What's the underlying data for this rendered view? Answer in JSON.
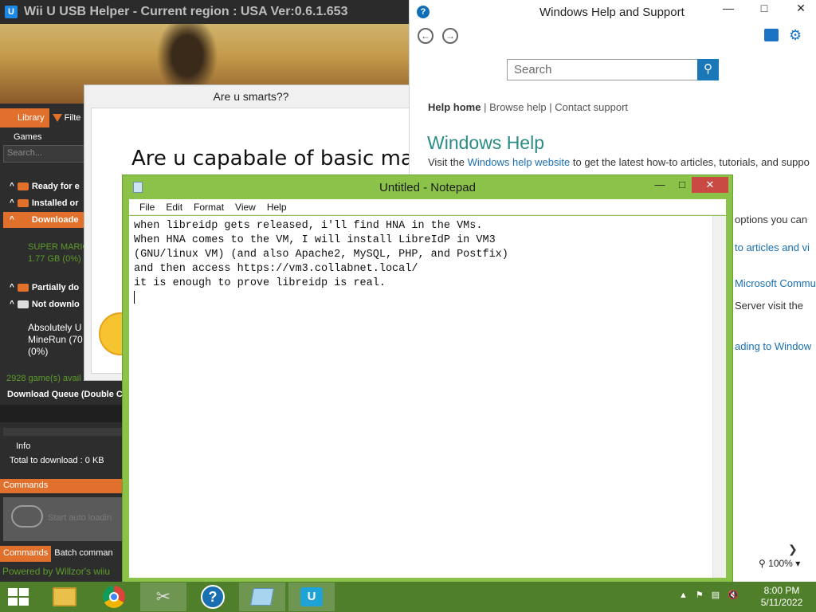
{
  "wiiu": {
    "title": "Wii U USB Helper - Current region : USA Ver:0.6.1.653",
    "tab_library": "Library",
    "tab_filter": "Filte",
    "games_label": "Games",
    "search_placeholder": "Search...",
    "categories": [
      {
        "label": "Ready for e"
      },
      {
        "label": "Installed or"
      },
      {
        "label": "Downloade"
      },
      {
        "label": "Partially do"
      },
      {
        "label": "Not downlo"
      }
    ],
    "download_green_1": "SUPER MARIO",
    "download_green_2": "1.77 GB (0%)",
    "not_downloaded_item_1": "Absolutely U",
    "not_downloaded_item_2": "MineRun (70",
    "not_downloaded_item_3": "(0%)",
    "games_available": "2928 game(s) avail",
    "download_queue": "Download Queue (Double C",
    "info_label": "Info",
    "total_to_download": "Total to download :  0 KB",
    "commands_label": "Commands",
    "cloud_text": "Start auto loadin",
    "bottom_tab_commands": "Commands",
    "bottom_tab_batch": "Batch comman",
    "powered_by": "Powered by  Willzor's wiiu"
  },
  "quiz": {
    "title": "Are u smarts??",
    "question": "Are u capabale of basic mat"
  },
  "help": {
    "title": "Windows Help and Support",
    "search_placeholder": "Search",
    "link_home": "Help home",
    "link_browse": "Browse help",
    "link_contact": "Contact support",
    "heading": "Windows Help",
    "para_prefix": "Visit the ",
    "para_link": "Windows help website",
    "para_suffix": " to get the latest how-to articles, tutorials, and suppo",
    "snip_1": "options you can",
    "snip_2": "to articles and vi",
    "snip_3": "Microsoft Commu",
    "snip_4": "Server visit the",
    "snip_5": "ading to Window",
    "zoom": "100%"
  },
  "notepad": {
    "title": "Untitled - Notepad",
    "menu": [
      "File",
      "Edit",
      "Format",
      "View",
      "Help"
    ],
    "text": "when libreidp gets released, i'll find HNA in the VMs.\nWhen HNA comes to the VM, I will install LibreIdP in VM3\n(GNU/linux VM) (and also Apache2, MySQL, PHP, and Postfix)\nand then access https://vm3.collabnet.local/\nit is enough to prove libreidp is real."
  },
  "taskbar": {
    "time": "8:00 PM",
    "date": "5/11/2022"
  }
}
